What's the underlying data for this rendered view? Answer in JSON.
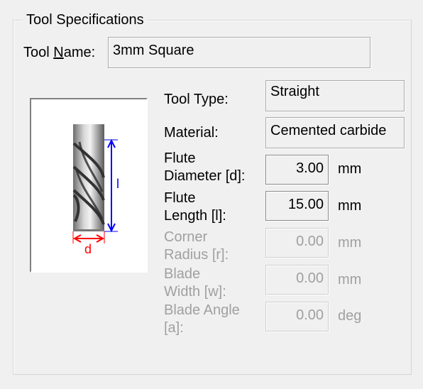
{
  "group": {
    "title": "Tool Specifications"
  },
  "tool_name": {
    "label_prefix": "Tool ",
    "label_access": "N",
    "label_suffix": "ame:",
    "value": "3mm Square"
  },
  "diagram": {
    "length_symbol": "l",
    "diameter_symbol": "d"
  },
  "tool_type": {
    "label": "Tool Type:",
    "value": "Straight"
  },
  "material": {
    "label": "Material:",
    "value": "Cemented carbide"
  },
  "flute_diameter": {
    "label_line1": "Flute",
    "label_line2": "Diameter [d]:",
    "value": "3.00",
    "unit": "mm"
  },
  "flute_length": {
    "label_line1": "Flute",
    "label_line2": "Length [l]:",
    "value": "15.00",
    "unit": "mm"
  },
  "corner_radius": {
    "label_line1": "Corner",
    "label_line2": "Radius [r]:",
    "value": "0.00",
    "unit": "mm"
  },
  "blade_width": {
    "label_line1": "Blade",
    "label_line2": "Width [w]:",
    "value": "0.00",
    "unit": "mm"
  },
  "blade_angle": {
    "label_line1": "Blade Angle",
    "label_line2": "[a]:",
    "value": "0.00",
    "unit": "deg"
  },
  "colors": {
    "dimension_blue": "#0000ff",
    "dimension_red": "#ff0000",
    "disabled_text": "#a0a0a0"
  }
}
